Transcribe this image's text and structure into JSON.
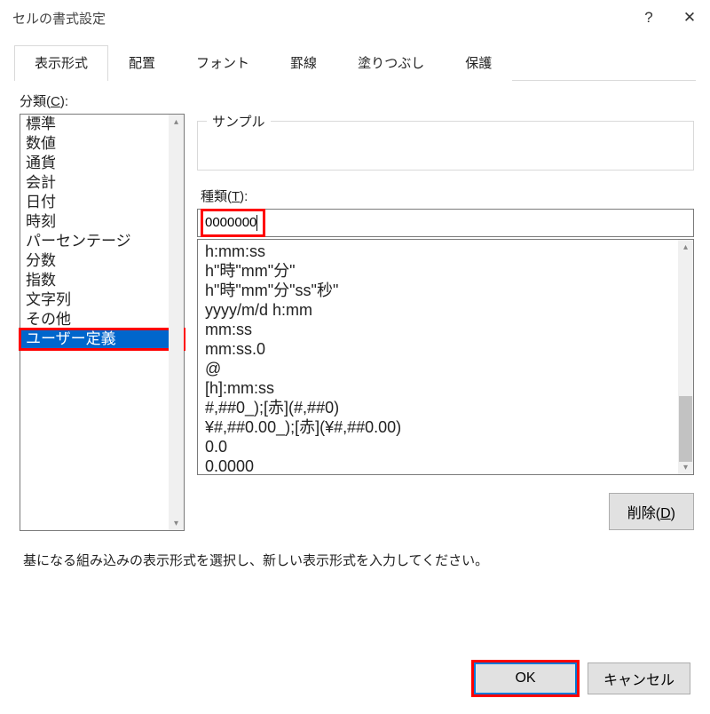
{
  "window": {
    "title": "セルの書式設定"
  },
  "tabs": [
    "表示形式",
    "配置",
    "フォント",
    "罫線",
    "塗りつぶし",
    "保護"
  ],
  "active_tab": 0,
  "category": {
    "label_prefix": "分類(",
    "label_key": "C",
    "label_suffix": "):",
    "items": [
      "標準",
      "数値",
      "通貨",
      "会計",
      "日付",
      "時刻",
      "パーセンテージ",
      "分数",
      "指数",
      "文字列",
      "その他",
      "ユーザー定義"
    ],
    "selected_index": 11
  },
  "sample": {
    "legend": "サンプル",
    "value": ""
  },
  "type": {
    "label_prefix": "種類(",
    "label_key": "T",
    "label_suffix": "):",
    "value": "0000000"
  },
  "formats": [
    "h:mm:ss",
    "h\"時\"mm\"分\"",
    "h\"時\"mm\"分\"ss\"秒\"",
    "yyyy/m/d h:mm",
    "mm:ss",
    "mm:ss.0",
    "@",
    "[h]:mm:ss",
    "#,##0_);[赤](#,##0)",
    "¥#,##0.00_);[赤](¥#,##0.00)",
    "0.0",
    "0.0000"
  ],
  "delete": {
    "label_prefix": "削除(",
    "label_key": "D",
    "label_suffix": ")"
  },
  "hint": "基になる組み込みの表示形式を選択し、新しい表示形式を入力してください。",
  "buttons": {
    "ok": "OK",
    "cancel": "キャンセル"
  },
  "icons": {
    "help": "?",
    "close": "✕",
    "up": "▴",
    "down": "▾"
  }
}
